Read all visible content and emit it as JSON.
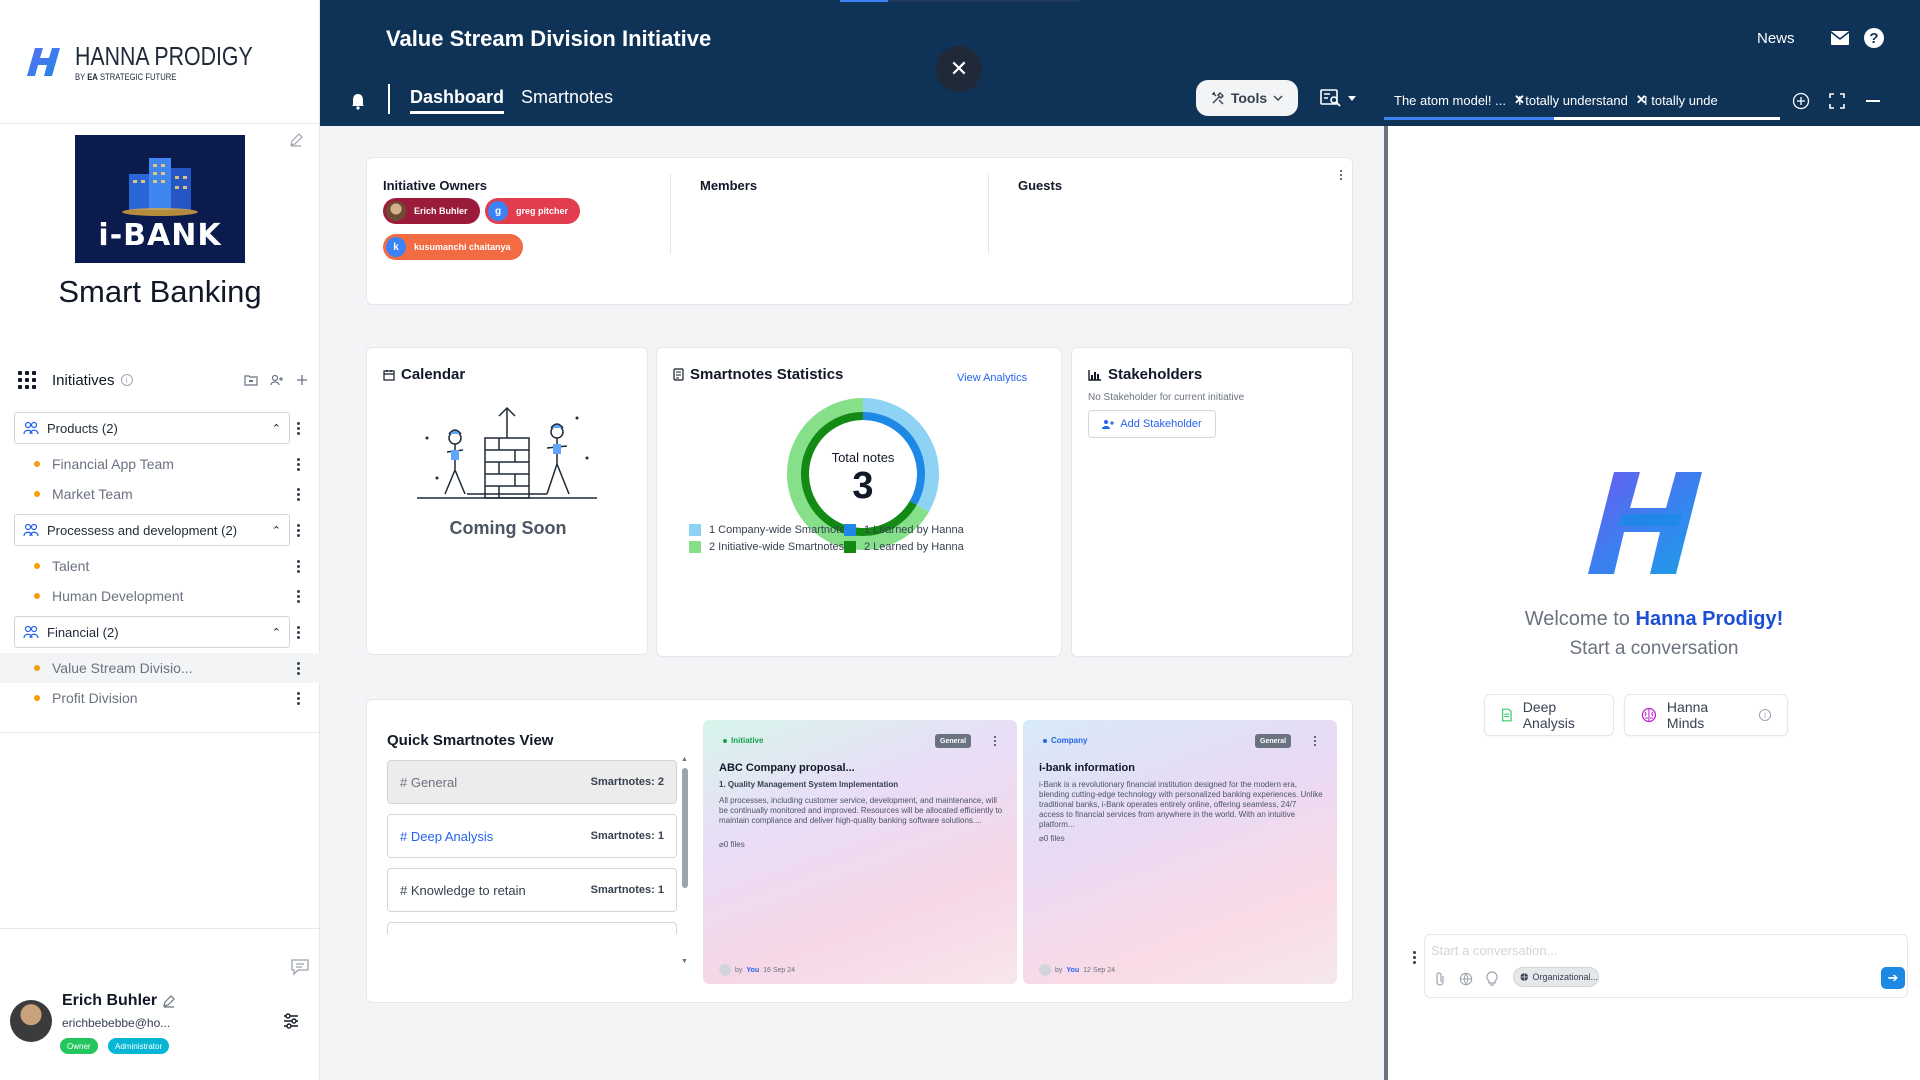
{
  "brand": {
    "name": "HANNA PRODIGY",
    "by": "BY",
    "ea": "EA",
    "strategic": "STRATEGIC FUTURE"
  },
  "org": {
    "logo_text": "i-BANK",
    "name": "Smart Banking"
  },
  "initiatives": {
    "title": "Initiatives",
    "groups": [
      {
        "label": "Products (2)",
        "items": [
          "Financial App Team",
          "Market Team"
        ]
      },
      {
        "label": "Processess and development (2)",
        "items": [
          "Talent",
          "Human Development"
        ]
      },
      {
        "label": "Financial (2)",
        "items": [
          "Value Stream Divisio...",
          "Profit Division"
        ]
      }
    ],
    "active_item": "Value Stream Divisio..."
  },
  "user": {
    "name": "Erich Buhler",
    "email": "erichbebebbe@ho...",
    "badges": [
      "Owner",
      "Administrator"
    ]
  },
  "header": {
    "title": "Value Stream Division Initiative",
    "tabs": [
      "Dashboard",
      "Smartnotes"
    ],
    "active_tab": "Dashboard",
    "news": "News",
    "tools": "Tools",
    "chat_tabs": [
      "The atom model! ...",
      "I totally understand",
      "I totally unde"
    ]
  },
  "owners": {
    "col_owners": "Initiative Owners",
    "col_members": "Members",
    "col_guests": "Guests",
    "chips": [
      {
        "initial": "",
        "name": "Erich Buhler"
      },
      {
        "initial": "g",
        "name": "greg pitcher"
      },
      {
        "initial": "k",
        "name": "kusumanchi chaitanya"
      }
    ]
  },
  "calendar": {
    "title": "Calendar",
    "status": "Coming Soon"
  },
  "stats": {
    "title": "Smartnotes Statistics",
    "link": "View Analytics",
    "center_label": "Total notes",
    "center_value": "3",
    "legend": [
      {
        "label": "1 Company-wide Smartnotes",
        "color": "#8fd3f4"
      },
      {
        "label": "1 Learned by Hanna",
        "color": "#1e88e5"
      },
      {
        "label": "2 Initiative-wide Smartnotes",
        "color": "#86e08a"
      },
      {
        "label": "2 Learned by Hanna",
        "color": "#138a13"
      }
    ]
  },
  "chart_data": {
    "type": "pie",
    "subtype": "donut",
    "title": "Total notes",
    "center_value": 3,
    "outer_ring": [
      {
        "name": "Company-wide Smartnotes",
        "value": 1,
        "color": "#8fd3f4"
      },
      {
        "name": "Initiative-wide Smartnotes",
        "value": 2,
        "color": "#86e08a"
      }
    ],
    "inner_ring": [
      {
        "name": "Learned by Hanna",
        "value": 1,
        "color": "#1e88e5"
      },
      {
        "name": "Learned by Hanna",
        "value": 2,
        "color": "#138a13"
      }
    ]
  },
  "stakeholders": {
    "title": "Stakeholders",
    "empty": "No Stakeholder for current initiative",
    "add": "Add Stakeholder"
  },
  "quick": {
    "title": "Quick Smartnotes View",
    "items": [
      {
        "label": "# General",
        "count": "Smartnotes: 2"
      },
      {
        "label": "# Deep Analysis",
        "count": "Smartnotes: 1"
      },
      {
        "label": "# Knowledge to retain",
        "count": "Smartnotes: 1"
      }
    ]
  },
  "notes": [
    {
      "tag": "Initiative",
      "tag_color": "#16a34a",
      "badge": "General",
      "title": "ABC Company proposal...",
      "subtitle": "1. Quality Management System Implementation",
      "body": "All processes, including customer service, development, and maintenance, will be continually monitored and improved. Resources will be allocated efficiently to maintain compliance and deliver high-quality banking software solutions....",
      "files": "0 files",
      "by": "by",
      "author": "You",
      "date": "16 Sep 24"
    },
    {
      "tag": "Company",
      "tag_color": "#2563eb",
      "badge": "General",
      "title": "i-bank information",
      "subtitle": "",
      "body": "i-Bank is a revolutionary financial institution designed for the modern era, blending cutting-edge technology with personalized banking experiences. Unlike traditional banks, i-Bank operates entirely online, offering seamless, 24/7 access to financial services from anywhere in the world. With an intuitive platform...",
      "files": "0 files",
      "by": "by",
      "author": "You",
      "date": "12 Sep 24"
    }
  ],
  "chat": {
    "welcome_prefix": "Welcome to",
    "welcome_brand": "Hanna Prodigy!",
    "start": "Start a conversation",
    "actions": [
      "Deep Analysis",
      "Hanna Minds"
    ],
    "placeholder": "Start a conversation...",
    "context_pill": "Organizational..."
  }
}
